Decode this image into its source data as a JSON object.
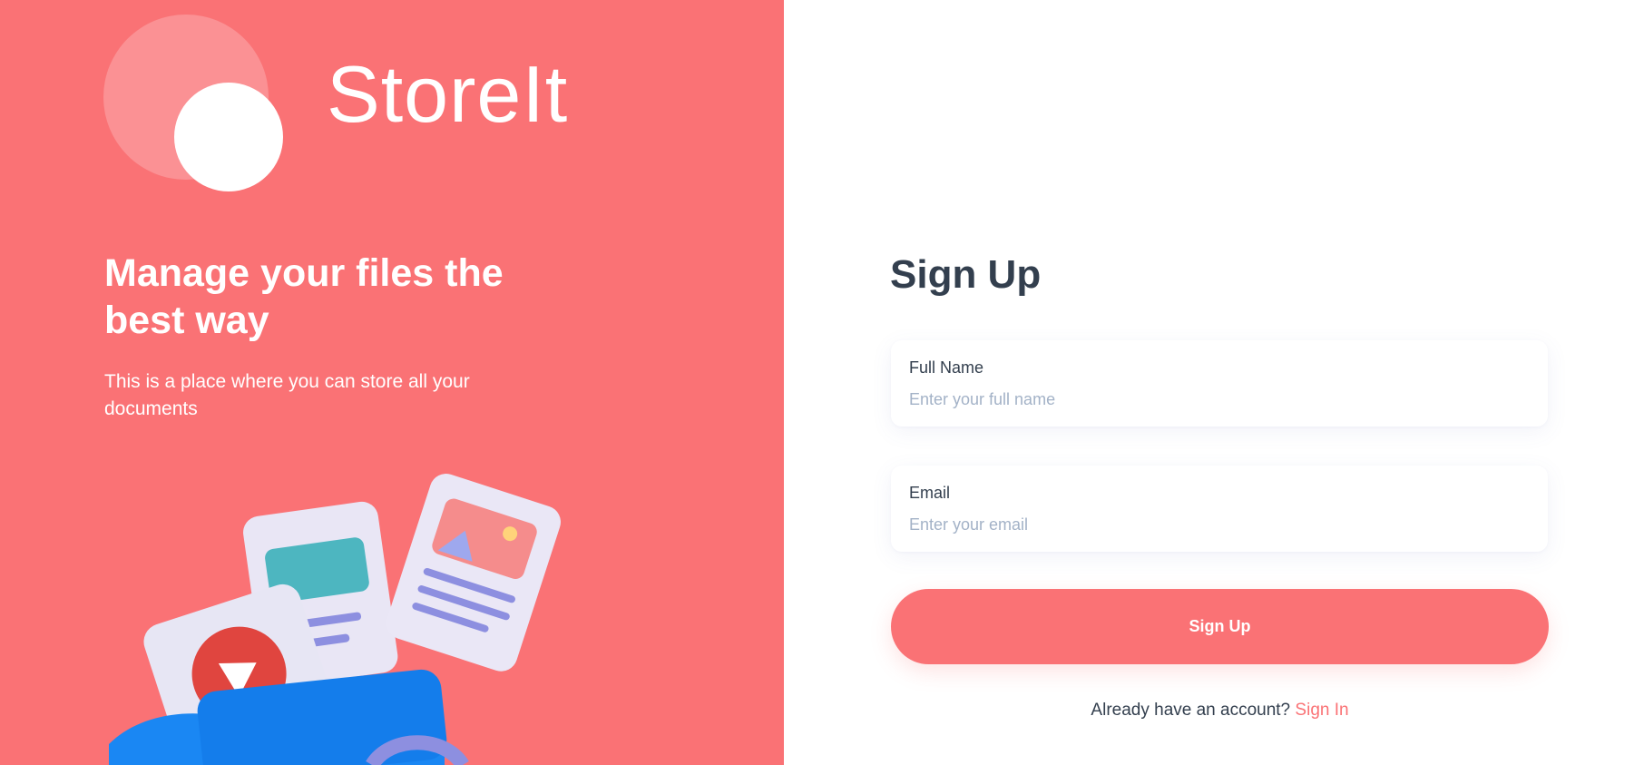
{
  "brand": {
    "name": "StoreIt"
  },
  "hero": {
    "title": "Manage your files the best way",
    "subtitle": "This is a place where you can store all your documents"
  },
  "form": {
    "title": "Sign Up",
    "fields": [
      {
        "label": "Full Name",
        "placeholder": "Enter your full name",
        "value": ""
      },
      {
        "label": "Email",
        "placeholder": "Enter your email",
        "value": ""
      }
    ],
    "submit_label": "Sign Up",
    "switch_prompt": "Already have an account?",
    "switch_link": "Sign In"
  },
  "colors": {
    "brand": "#FA7275",
    "heading": "#333F4E",
    "placeholder": "#A3B2C7"
  },
  "icons": {
    "illustration": "files-illustration-icon"
  }
}
